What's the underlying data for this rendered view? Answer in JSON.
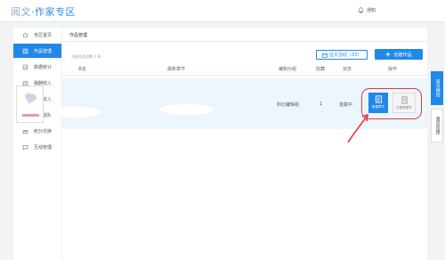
{
  "header": {
    "logo_brand": "阅文",
    "logo_dot": "·",
    "logo_title": "作家专区",
    "notify_label": "通知"
  },
  "sidebar": {
    "items": [
      {
        "label": "专区首页",
        "icon": "home-icon"
      },
      {
        "label": "作品管理",
        "icon": "book-icon",
        "active": true
      },
      {
        "label": "数据统计",
        "icon": "chart-icon"
      },
      {
        "label": "稿酬收入",
        "icon": "wallet-icon"
      },
      {
        "label": "劳务收入",
        "icon": "coins-icon"
      },
      {
        "label": "作家进阶",
        "icon": "user-icon"
      },
      {
        "label": "积分兑换",
        "icon": "gift-icon"
      },
      {
        "label": "互动管理",
        "icon": "chat-icon"
      }
    ]
  },
  "main": {
    "title": "作品管理",
    "count_text": "当前作品总数 1 本",
    "activity_button": "征文活动（33）",
    "create_button": "创建作品",
    "columns": [
      "书名",
      "最新章节",
      "编辑分组",
      "收藏",
      "状态",
      "操作"
    ],
    "row": {
      "editor_group": "科幻编辑组",
      "collections": "1",
      "status": "连载中",
      "op_new_chapter": "新建章节",
      "op_chapter_manage": "已发布章节"
    }
  },
  "right_tabs": {
    "tab1": "官方微信",
    "tab2": "意见反馈"
  },
  "colors": {
    "accent": "#2288e8",
    "highlight_red": "#e03a3a",
    "row_bg": "#eef6fd"
  }
}
